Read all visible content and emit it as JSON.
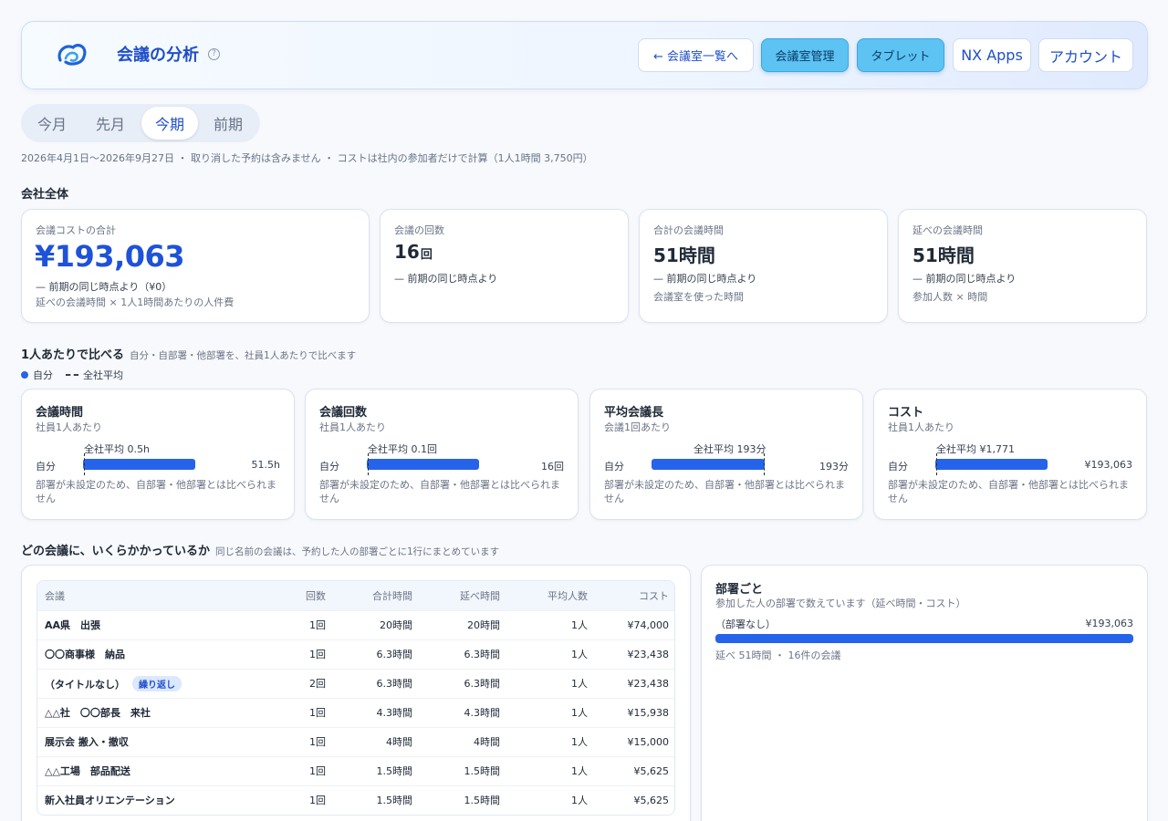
{
  "header": {
    "title": "会議の分析",
    "help_icon": "?",
    "buttons": {
      "back": "← 会議室一覧へ",
      "room_manage": "会議室管理",
      "tablet": "タブレット",
      "nx_apps": "NX Apps",
      "account": "アカウント"
    },
    "colors": {
      "accent": "#1e4fc9",
      "solid_button": "#5cc3f2"
    }
  },
  "period_tabs": {
    "items": [
      "今月",
      "先月",
      "今期",
      "前期"
    ],
    "active": "今期"
  },
  "caption": "2026年4月1日〜2026年9月27日 ・ 取り消した予約は含みません ・ コストは社内の参加者だけで計算（1人1時間 3,750円）",
  "company": {
    "section_title": "会社全体",
    "cards": [
      {
        "label": "会議コストの合計",
        "value": "¥193,063",
        "note": "— 前期の同じ時点より（¥0）",
        "note2": "延べの会議時間 × 1人1時間あたりの人件費"
      },
      {
        "label": "会議の回数",
        "value": "16",
        "unit": "回",
        "note": "— 前期の同じ時点より",
        "note2": ""
      },
      {
        "label": "合計の会議時間",
        "value": "51時間",
        "unit": "",
        "note": "— 前期の同じ時点より",
        "note2": "会議室を使った時間"
      },
      {
        "label": "延べの会議時間",
        "value": "51時間",
        "unit": "",
        "note": "— 前期の同じ時点より",
        "note2": "参加人数 × 時間"
      }
    ]
  },
  "per_person": {
    "section_title": "1人あたりで比べる",
    "section_sub": "自分・自部署・他部署を、社員1人あたりで比べます",
    "legend": {
      "self": "自分",
      "company_avg": "全社平均"
    },
    "self_label": "自分",
    "note": "部署が未設定のため、自部署・他部署とは比べられません",
    "cards": [
      {
        "title": "会議時間",
        "sub": "社員1人あたり",
        "avg_label": "全社平均 0.5h",
        "value": "51.5h",
        "self_fill": 1.0,
        "avg_fill": 0.01
      },
      {
        "title": "会議回数",
        "sub": "社員1人あたり",
        "avg_label": "全社平均 0.1回",
        "value": "16回",
        "self_fill": 1.0,
        "avg_fill": 0.006
      },
      {
        "title": "平均会議長",
        "sub": "会議1回あたり",
        "avg_label": "全社平均 193分",
        "value": "193分",
        "self_fill": 1.0,
        "avg_fill": 1.0
      },
      {
        "title": "コスト",
        "sub": "社員1人あたり",
        "avg_label": "全社平均 ¥1,771",
        "value": "¥193,063",
        "self_fill": 1.0,
        "avg_fill": 0.009
      }
    ]
  },
  "meetings": {
    "section_title": "どの会議に、いくらかかっているか",
    "section_sub": "同じ名前の会議は、予約した人の部署ごとに1行にまとめています",
    "columns": [
      "会議",
      "回数",
      "合計時間",
      "延べ時間",
      "平均人数",
      "コスト"
    ],
    "rows": [
      {
        "name": "AA県　出張",
        "badge": "",
        "count": "1回",
        "total": "20時間",
        "person": "20時間",
        "avg": "1人",
        "cost": "¥74,000"
      },
      {
        "name": "〇〇商事様　納品",
        "badge": "",
        "count": "1回",
        "total": "6.3時間",
        "person": "6.3時間",
        "avg": "1人",
        "cost": "¥23,438"
      },
      {
        "name": "（タイトルなし）",
        "badge": "繰り返し",
        "count": "2回",
        "total": "6.3時間",
        "person": "6.3時間",
        "avg": "1人",
        "cost": "¥23,438"
      },
      {
        "name": "△△社　〇〇部長　来社",
        "badge": "",
        "count": "1回",
        "total": "4.3時間",
        "person": "4.3時間",
        "avg": "1人",
        "cost": "¥15,938"
      },
      {
        "name": "展示会 搬入・撤収",
        "badge": "",
        "count": "1回",
        "total": "4時間",
        "person": "4時間",
        "avg": "1人",
        "cost": "¥15,000"
      },
      {
        "name": "△△工場　部品配送",
        "badge": "",
        "count": "1回",
        "total": "1.5時間",
        "person": "1.5時間",
        "avg": "1人",
        "cost": "¥5,625"
      },
      {
        "name": "新入社員オリエンテーション",
        "badge": "",
        "count": "1回",
        "total": "1.5時間",
        "person": "1.5時間",
        "avg": "1人",
        "cost": "¥5,625"
      }
    ]
  },
  "departments": {
    "title": "部署ごと",
    "sub": "参加した人の部署で数えています（延べ時間・コスト）",
    "items": [
      {
        "name": "（部署なし）",
        "cost": "¥193,063",
        "fill": 1.0,
        "meta": "延べ 51時間 ・ 16件の会議"
      }
    ]
  }
}
